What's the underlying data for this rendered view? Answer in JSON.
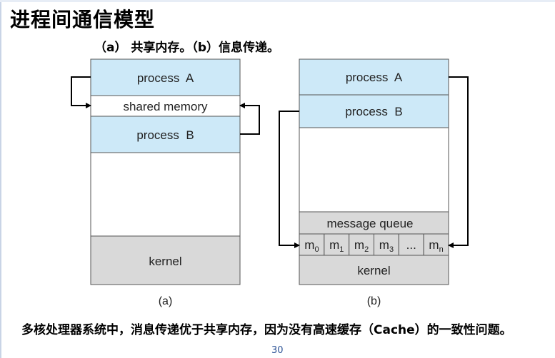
{
  "slide": {
    "title": "进程间通信模型",
    "subtitle": "（a） 共享内存。（b）信息传递。",
    "footnote": "多核处理器系统中，消息传递优于共享内存，因为没有高速缓存（Cache）的一致性问题。",
    "page_number": "30"
  },
  "diagram_a": {
    "process_a": "process  A",
    "shared_memory": "shared memory",
    "process_b": "process  B",
    "kernel": "kernel",
    "caption": "(a)"
  },
  "diagram_b": {
    "process_a": "process  A",
    "process_b": "process  B",
    "message_queue": "message queue",
    "messages": [
      {
        "base": "m",
        "sub": "0"
      },
      {
        "base": "m",
        "sub": "1"
      },
      {
        "base": "m",
        "sub": "2"
      },
      {
        "base": "m",
        "sub": "3"
      },
      {
        "base": "...",
        "sub": ""
      },
      {
        "base": "m",
        "sub": "n"
      }
    ],
    "kernel": "kernel",
    "caption": "(b)"
  },
  "colors": {
    "process_fill": "#cde9f8",
    "kernel_fill": "#d9d9d9",
    "border": "#555555"
  }
}
